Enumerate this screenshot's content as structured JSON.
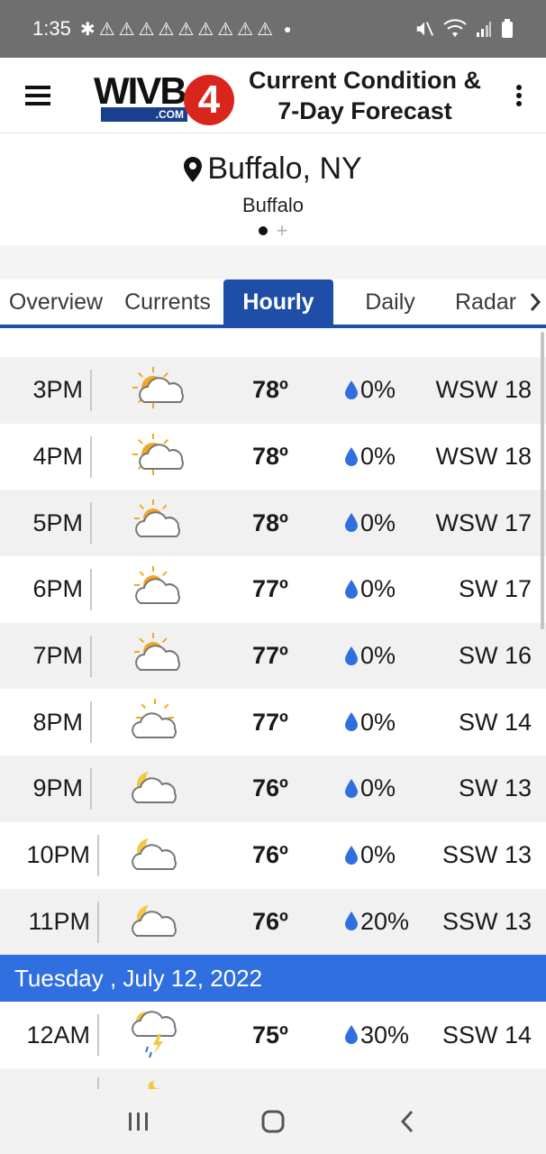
{
  "status": {
    "time": "1:35",
    "alert_icons": [
      "slack-icon",
      "warning-icon",
      "warning-icon",
      "warning-icon",
      "warning-icon",
      "warning-icon",
      "warning-icon",
      "warning-icon",
      "warning-icon",
      "warning-icon"
    ],
    "right_icons": [
      "mute-icon",
      "wifi-icon",
      "signal-icon",
      "battery-icon"
    ]
  },
  "header": {
    "logo_text": "WIVB",
    "logo_number": "4",
    "logo_domain": ".COM",
    "title_line1": "Current Condition &",
    "title_line2": "7-Day Forecast"
  },
  "location": {
    "city": "Buffalo, NY",
    "sub": "Buffalo"
  },
  "tabs": [
    {
      "label": "Overview",
      "active": false
    },
    {
      "label": "Currents",
      "active": false
    },
    {
      "label": "Hourly",
      "active": true
    },
    {
      "label": "Daily",
      "active": false
    },
    {
      "label": "Radar",
      "active": false
    }
  ],
  "hourly": [
    {
      "time": "3PM",
      "icon": "partly-sunny-icon",
      "temp": "78º",
      "precip": "0%",
      "wind": "WSW 18"
    },
    {
      "time": "4PM",
      "icon": "partly-sunny-icon",
      "temp": "78º",
      "precip": "0%",
      "wind": "WSW 18"
    },
    {
      "time": "5PM",
      "icon": "mostly-cloudy-sun-icon",
      "temp": "78º",
      "precip": "0%",
      "wind": "WSW 17"
    },
    {
      "time": "6PM",
      "icon": "mostly-cloudy-sun-icon",
      "temp": "77º",
      "precip": "0%",
      "wind": "SW 17"
    },
    {
      "time": "7PM",
      "icon": "mostly-cloudy-sun-icon",
      "temp": "77º",
      "precip": "0%",
      "wind": "SW 16"
    },
    {
      "time": "8PM",
      "icon": "cloudy-sun-icon",
      "temp": "77º",
      "precip": "0%",
      "wind": "SW 14"
    },
    {
      "time": "9PM",
      "icon": "partly-cloudy-night-icon",
      "temp": "76º",
      "precip": "0%",
      "wind": "SW 13"
    },
    {
      "time": "10PM",
      "icon": "partly-cloudy-night-icon",
      "temp": "76º",
      "precip": "0%",
      "wind": "SSW 13"
    },
    {
      "time": "11PM",
      "icon": "partly-cloudy-night-icon",
      "temp": "76º",
      "precip": "20%",
      "wind": "SSW 13"
    }
  ],
  "day_header": "Tuesday , July 12, 2022",
  "hourly_next": [
    {
      "time": "12AM",
      "icon": "night-thunderstorm-icon",
      "temp": "75º",
      "precip": "30%",
      "wind": "SSW 14"
    }
  ],
  "colors": {
    "accent": "#1e4ea8",
    "day_header": "#2f6fe0",
    "drop": "#2f6fe0",
    "sun": "#f5a623",
    "moon": "#f5c842"
  }
}
